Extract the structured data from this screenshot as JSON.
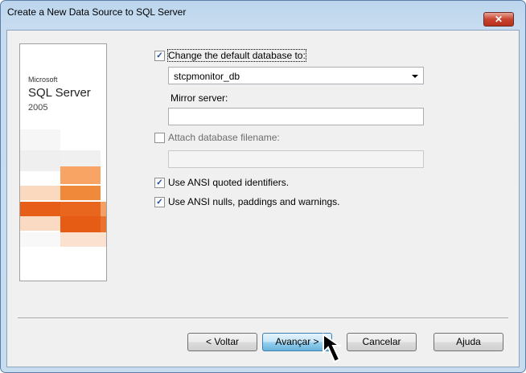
{
  "window": {
    "title": "Create a New Data Source to SQL Server",
    "close_glyph": "✕"
  },
  "banner": {
    "company": "Microsoft",
    "product": "SQL Server",
    "version": "2005"
  },
  "options": {
    "change_default_db": {
      "label": "Change the default database to:",
      "checked": true
    },
    "database_value": "stcpmonitor_db",
    "mirror_label": "Mirror server:",
    "mirror_value": "",
    "attach_db": {
      "label": "Attach database filename:",
      "checked": false
    },
    "attach_value": "",
    "ansi_quoted": {
      "label": "Use ANSI quoted identifiers.",
      "checked": true
    },
    "ansi_nulls": {
      "label": "Use ANSI nulls, paddings and warnings.",
      "checked": true
    }
  },
  "buttons": {
    "back": "< Voltar",
    "next": "Avançar >",
    "cancel": "Cancelar",
    "help": "Ajuda"
  },
  "check_glyph": "✓",
  "colors": {
    "accent_orange": "#e8661d",
    "title_bg": "#c6dbef"
  }
}
